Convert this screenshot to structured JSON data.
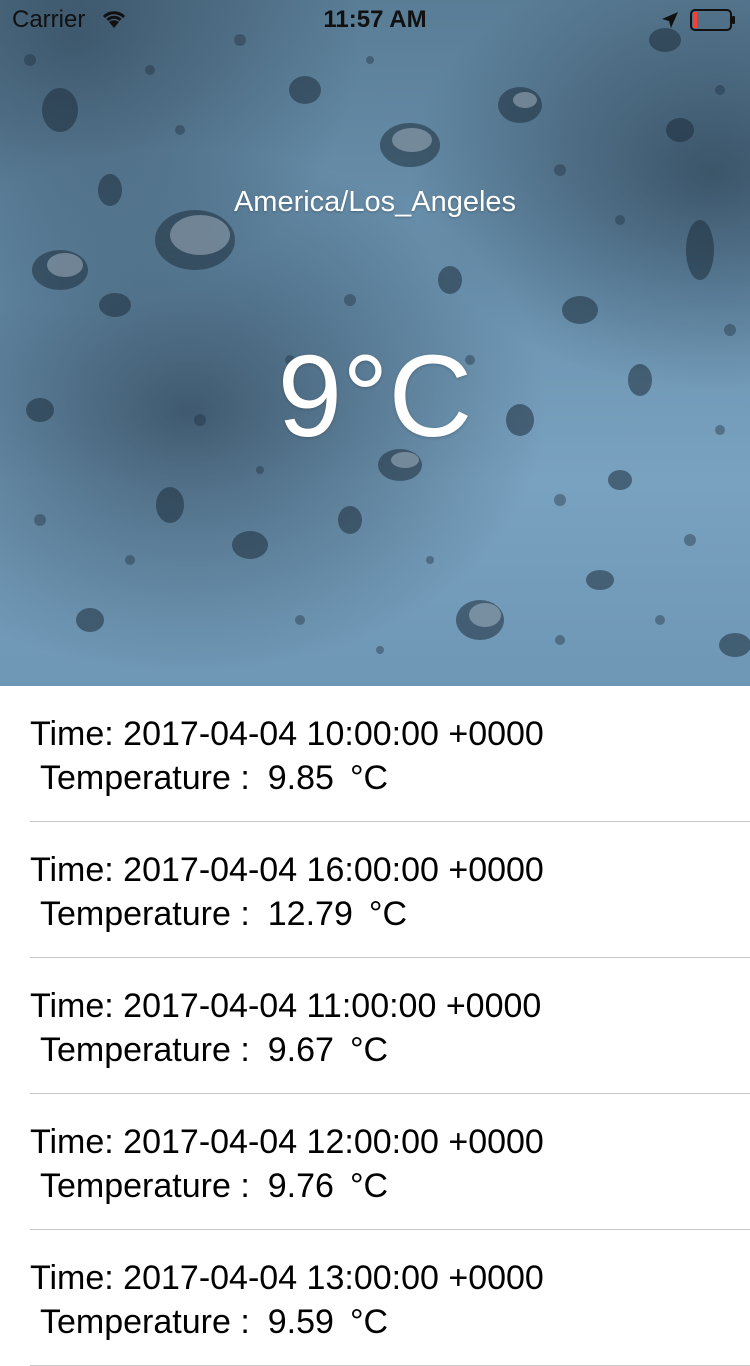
{
  "status_bar": {
    "carrier": "Carrier",
    "time": "11:57 AM",
    "battery_color": "#ff3b30"
  },
  "weather": {
    "city": "America/Los_Angeles",
    "current_temp": "9°C"
  },
  "forecast": [
    {
      "time_label": "Time: 2017-04-04 10:00:00 +0000",
      "temp_label": "Temperature :",
      "temp_value": "9.85",
      "unit": "°C"
    },
    {
      "time_label": "Time: 2017-04-04 16:00:00 +0000",
      "temp_label": "Temperature :",
      "temp_value": "12.79",
      "unit": "°C"
    },
    {
      "time_label": "Time: 2017-04-04 11:00:00 +0000",
      "temp_label": "Temperature :",
      "temp_value": "9.67",
      "unit": "°C"
    },
    {
      "time_label": "Time: 2017-04-04 12:00:00 +0000",
      "temp_label": "Temperature :",
      "temp_value": "9.76",
      "unit": "°C"
    },
    {
      "time_label": "Time: 2017-04-04 13:00:00 +0000",
      "temp_label": "Temperature :",
      "temp_value": "9.59",
      "unit": "°C"
    }
  ],
  "icons": {
    "wifi": "wifi-icon",
    "location": "location-arrow-icon",
    "battery": "battery-icon"
  }
}
